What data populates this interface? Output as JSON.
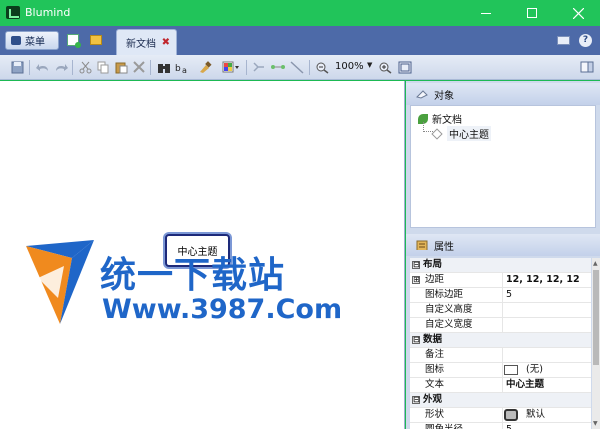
{
  "window": {
    "title": "Blumind"
  },
  "tabstrip": {
    "menu_label": "菜单",
    "doc_tab_label": "新文档",
    "tab_close_glyph": "✖",
    "help_glyph": "?"
  },
  "toolbar": {
    "zoom_value": "100%"
  },
  "canvas": {
    "topic_label": "中心主题"
  },
  "watermark": {
    "cn": "统一下载站",
    "url": "Www.3987.Com"
  },
  "objects_panel": {
    "title": "对象",
    "tree": {
      "root": "新文档",
      "child": "中心主题"
    }
  },
  "properties_panel": {
    "title": "属性",
    "rows": [
      {
        "type": "section",
        "name": "布局",
        "toggle": "⊟"
      },
      {
        "type": "prop",
        "name": "边距",
        "toggle": "⊞",
        "value": "12, 12, 12, 12",
        "bold": true
      },
      {
        "type": "prop",
        "name": "图标边距",
        "value": "5"
      },
      {
        "type": "prop",
        "name": "自定义高度",
        "value": ""
      },
      {
        "type": "prop",
        "name": "自定义宽度",
        "value": ""
      },
      {
        "type": "section",
        "name": "数据",
        "toggle": "⊟"
      },
      {
        "type": "prop",
        "name": "备注",
        "value": ""
      },
      {
        "type": "prop",
        "name": "图标",
        "value": "(无)",
        "swatch": true
      },
      {
        "type": "prop",
        "name": "文本",
        "value": "中心主题",
        "bold": true
      },
      {
        "type": "section",
        "name": "外观",
        "toggle": "⊟"
      },
      {
        "type": "prop",
        "name": "形状",
        "value": "默认",
        "shape": true
      },
      {
        "type": "prop",
        "name": "圆角半径",
        "value": "5"
      }
    ]
  },
  "colors": {
    "titlebar": "#21c45a",
    "tabstrip": "#4d6aa8",
    "node_border": "#1d2a7a",
    "watermark": "#1f66c8"
  }
}
